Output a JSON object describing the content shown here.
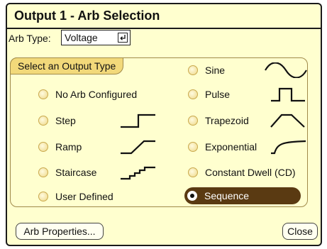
{
  "dialog": {
    "title": "Output 1 - Arb Selection",
    "arb_type_label": "Arb Type:",
    "arb_type_value": "Voltage",
    "group_label": "Select an Output Type"
  },
  "options": {
    "no_arb": "No Arb Configured",
    "step": "Step",
    "ramp": "Ramp",
    "staircase": "Staircase",
    "user_defined": "User Defined",
    "sine": "Sine",
    "pulse": "Pulse",
    "trapezoid": "Trapezoid",
    "exponential": "Exponential",
    "constant_dwell": "Constant Dwell (CD)",
    "sequence": "Sequence"
  },
  "selected_option": "Sequence",
  "buttons": {
    "arb_properties": "Arb Properties...",
    "close": "Close"
  },
  "colors": {
    "dialog_bg": "#ffffcf",
    "group_tab_bg": "#f2d97a",
    "selected_bg": "#5a3a12"
  }
}
